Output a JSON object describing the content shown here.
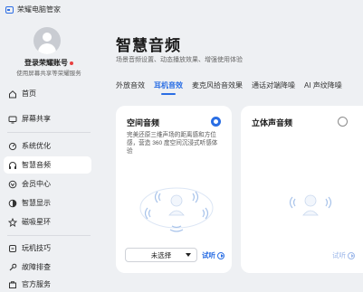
{
  "app": {
    "title": "荣耀电脑管家",
    "icon": "computer-manager-logo"
  },
  "account": {
    "login_label": "登录荣耀账号",
    "subtitle": "使用屏幕共享等荣耀服务"
  },
  "sidebar": {
    "items": [
      {
        "label": "首页",
        "icon": "home-icon"
      },
      {
        "label": "屏幕共享",
        "icon": "screen-share-icon"
      },
      {
        "label": "系统优化",
        "icon": "optimize-icon"
      },
      {
        "label": "智慧音频",
        "icon": "headphones-icon",
        "active": true
      },
      {
        "label": "会员中心",
        "icon": "member-icon"
      },
      {
        "label": "智慧显示",
        "icon": "display-icon"
      },
      {
        "label": "磁吸星环",
        "icon": "magnetic-ring-icon"
      },
      {
        "label": "玩机技巧",
        "icon": "tips-icon"
      },
      {
        "label": "故障排查",
        "icon": "troubleshoot-icon"
      },
      {
        "label": "官方服务",
        "icon": "service-icon"
      }
    ]
  },
  "main": {
    "title": "智慧音频",
    "subtitle": "场景音频设置、动态播放效果、增强使用体验",
    "tabs": [
      {
        "label": "外放音效"
      },
      {
        "label": "耳机音效",
        "active": true
      },
      {
        "label": "麦克风拾音效果"
      },
      {
        "label": "通话对端降噪"
      },
      {
        "label": "AI 声纹降噪"
      }
    ],
    "cards": [
      {
        "title": "空间音频",
        "selected": true,
        "description": "完美还原三维声场的距离感和方位感，营造 360 度空间沉浸式听感体验",
        "select_value": "未选择",
        "listen_label": "试听"
      },
      {
        "title": "立体声音频",
        "selected": false,
        "listen_label": "试听"
      }
    ]
  },
  "colors": {
    "accent": "#2a6ee4",
    "selected_nav_bg": "#ffffff",
    "page_bg": "#eef0f3"
  }
}
